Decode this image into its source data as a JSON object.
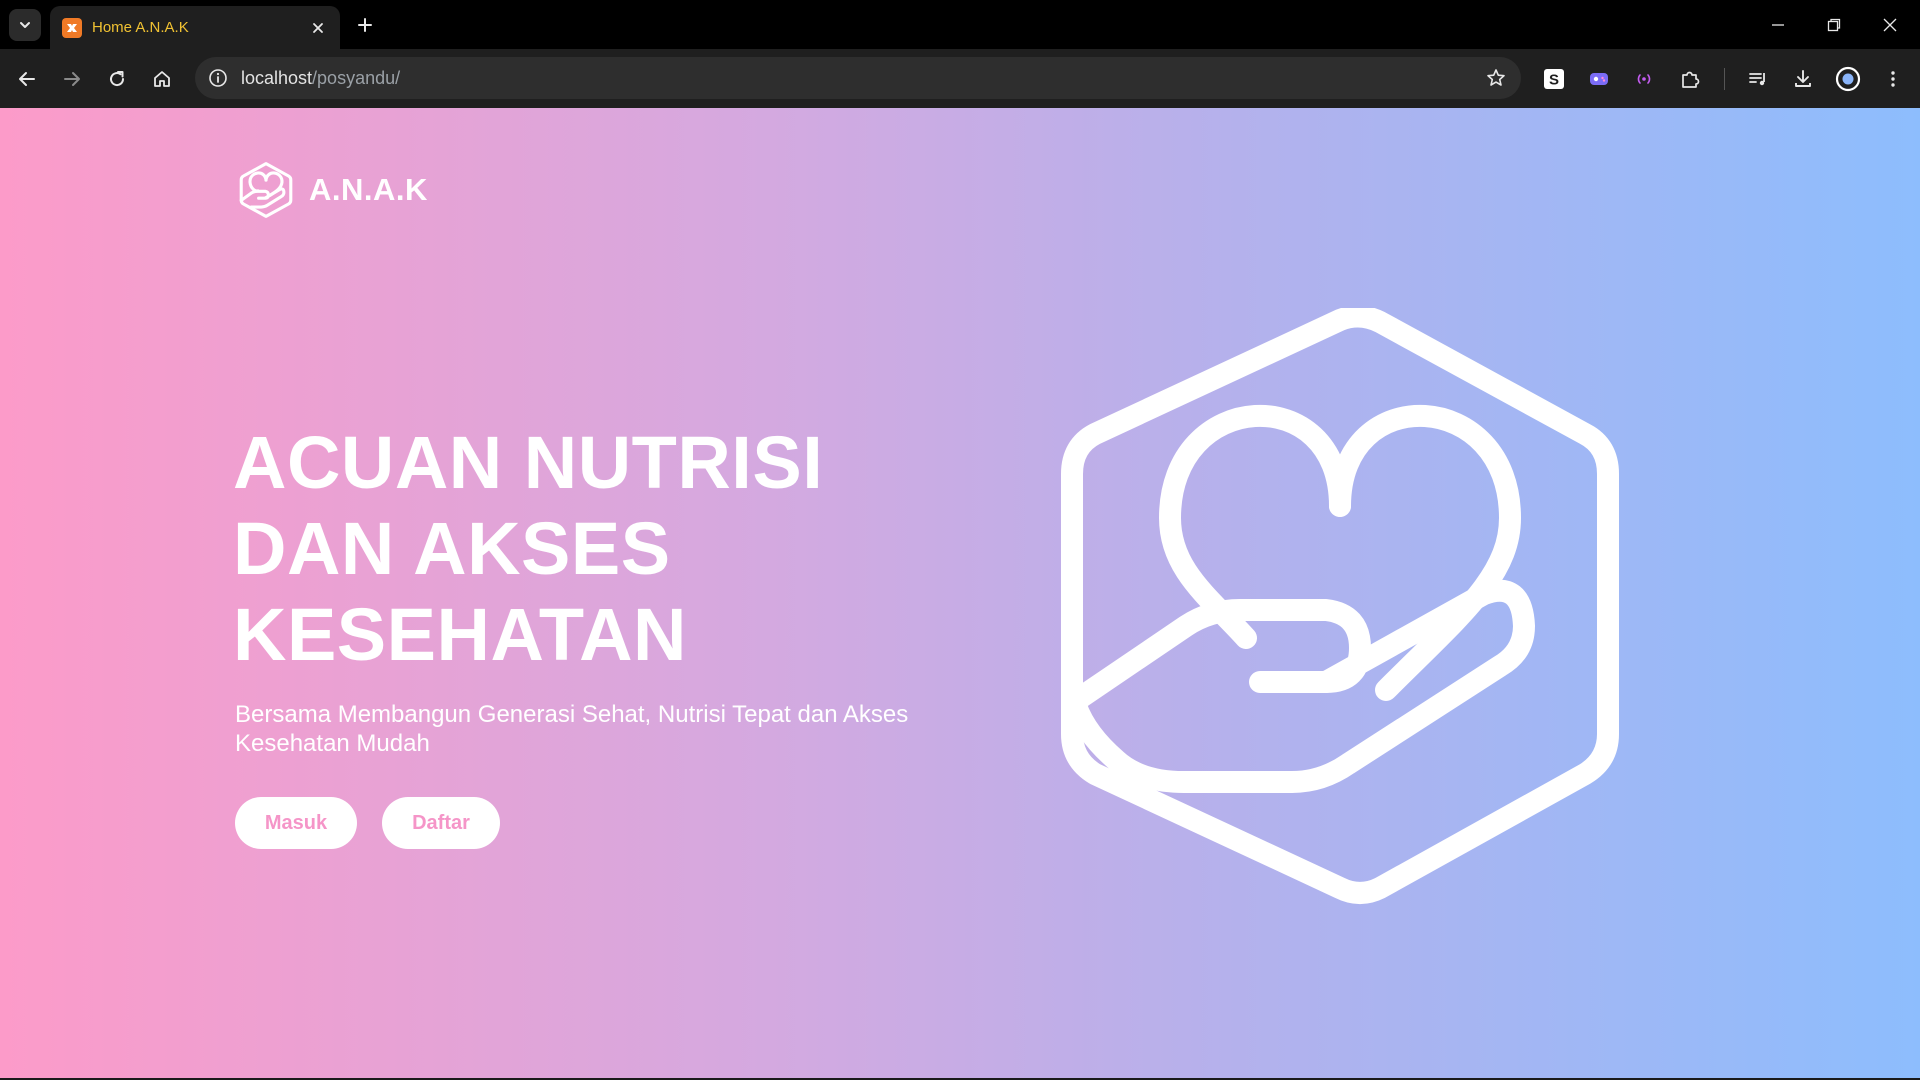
{
  "browser": {
    "tab": {
      "title": "Home A.N.A.K",
      "favicon": "xampp-icon"
    },
    "address": {
      "host": "localhost",
      "path": "/posyandu/"
    },
    "icons": {
      "tab_search": "chevron-down-icon",
      "tab_close": "close-icon",
      "new_tab": "plus-icon",
      "minimize": "minimize-icon",
      "restore": "restore-icon",
      "window_close": "close-icon",
      "back": "back-arrow-icon",
      "forward": "forward-arrow-icon",
      "reload": "reload-icon",
      "home": "home-icon",
      "site_info": "info-icon",
      "bookmark": "star-icon",
      "extensions": [
        "s-extension-icon",
        "game-controller-extension-icon",
        "radio-waves-extension-icon",
        "puzzle-icon"
      ],
      "media": "media-queue-icon",
      "downloads": "download-icon",
      "profile": "profile-icon",
      "menu": "kebab-menu-icon"
    }
  },
  "page": {
    "brand": {
      "name": "A.N.A.K",
      "logo": "hexagon-heart-hand-icon"
    },
    "hero": {
      "title_lines": [
        "ACUAN NUTRISI",
        "DAN AKSES",
        "KESEHATAN"
      ],
      "subtitle_line1": "Bersama Membangun Generasi Sehat, Nutrisi Tepat dan Akses",
      "subtitle_line2": "Kesehatan Mudah",
      "buttons": {
        "login": "Masuk",
        "register": "Daftar"
      },
      "illustration": "hexagon-heart-hand-icon"
    },
    "colors": {
      "gradient_start": "#fc9bc9",
      "gradient_mid": "#d4a9e0",
      "gradient_end": "#8dbdfd",
      "button_text": "#f595c8",
      "text": "#ffffff"
    }
  }
}
